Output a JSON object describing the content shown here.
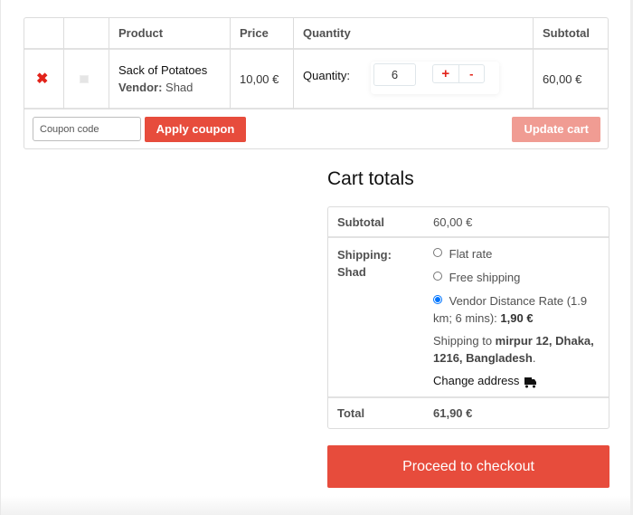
{
  "cart": {
    "headers": {
      "remove": "",
      "thumbnail": "",
      "product": "Product",
      "price": "Price",
      "quantity": "Quantity",
      "subtotal": "Subtotal"
    },
    "items": [
      {
        "remove_icon": "close-x-icon",
        "thumbnail_icon": "image-placeholder-icon",
        "name": "Sack of Potatoes",
        "vendor_label": "Vendor:",
        "vendor": "Shad",
        "price": "10,00 €",
        "quantity_label": "Quantity:",
        "quantity": "6",
        "plus_label": "+",
        "minus_label": "-",
        "subtotal": "60,00 €"
      }
    ],
    "coupon": {
      "placeholder": "Coupon code",
      "value": "",
      "apply_label": "Apply coupon"
    },
    "update_label": "Update cart"
  },
  "totals": {
    "title": "Cart totals",
    "subtotal_label": "Subtotal",
    "subtotal_value": "60,00 €",
    "shipping_label": "Shipping:",
    "shipping_vendor": "Shad",
    "shipping_options": [
      {
        "label": "Flat rate",
        "selected": false
      },
      {
        "label": "Free shipping",
        "selected": false
      },
      {
        "label": "Vendor Distance Rate (1.9 km; 6 mins): ",
        "price": "1,90 €",
        "selected": true
      }
    ],
    "shipping_to_prefix": "Shipping to ",
    "shipping_address": "mirpur 12, Dhaka, 1216, Bangladesh",
    "shipping_to_suffix": ".",
    "change_address_label": "Change address",
    "change_address_icon": "truck-icon",
    "total_label": "Total",
    "total_value": "61,90 €"
  },
  "checkout_label": "Proceed to checkout",
  "colors": {
    "accent": "#e74c3c",
    "accent_disabled": "#f09c93",
    "remove": "#e2231a",
    "radio_selected": "#1a73e8"
  }
}
